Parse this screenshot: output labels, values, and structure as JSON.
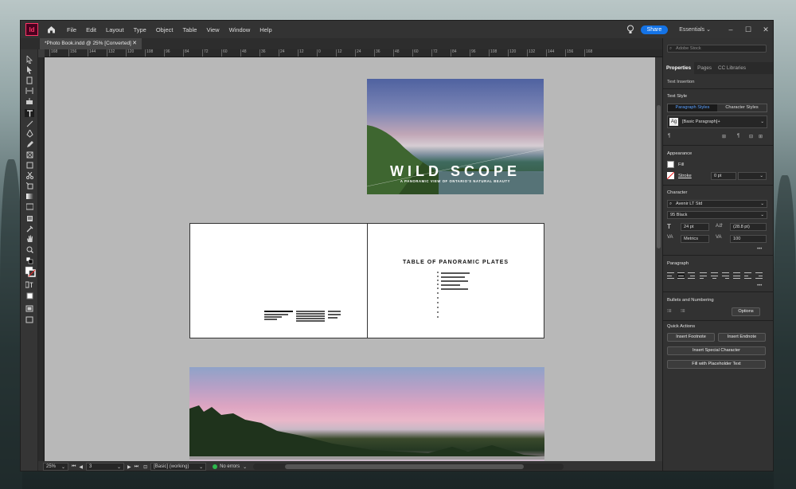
{
  "app": {
    "logo": "Id",
    "menu": [
      "File",
      "Edit",
      "Layout",
      "Type",
      "Object",
      "Table",
      "View",
      "Window",
      "Help"
    ],
    "share_label": "Share",
    "workspace": "Essentials",
    "search_placeholder": "Adobe Stock"
  },
  "document": {
    "tab_title": "*Photo Book.indd @ 25% [Converted]",
    "ruler_ticks": [
      "168",
      "156",
      "144",
      "132",
      "120",
      "108",
      "96",
      "84",
      "72",
      "60",
      "48",
      "36",
      "24",
      "12",
      "0",
      "12",
      "24",
      "36",
      "48",
      "60",
      "72",
      "84",
      "96",
      "108",
      "120",
      "132",
      "144",
      "156",
      "168"
    ],
    "cover_title": "WILD SCOPE",
    "cover_subtitle": "A PANORAMIC VIEW OF ONTARIO'S NATURAL BEAUTY",
    "toc_title": "TABLE OF PANORAMIC PLATES"
  },
  "status": {
    "zoom": "25%",
    "page": "3",
    "style": "[Basic] (working)",
    "errors": "No errors"
  },
  "panel": {
    "tabs": [
      "Properties",
      "Pages",
      "CC Libraries"
    ],
    "context": "Text Insertion",
    "text_style_label": "Text Style",
    "paragraph_styles": "Paragraph Styles",
    "character_styles": "Character Styles",
    "current_style": "[Basic Paragraph]+",
    "appearance_label": "Appearance",
    "fill_label": "Fill",
    "stroke_label": "Stroke",
    "stroke_weight": "0 pt",
    "character_label": "Character",
    "font_family": "Avenir LT Std",
    "font_style": "95 Black",
    "font_size": "24 pt",
    "leading": "(28.8 pt)",
    "kerning": "Metrics",
    "tracking": "100",
    "paragraph_label": "Paragraph",
    "bullets_label": "Bullets and Numbering",
    "options_label": "Options",
    "quick_actions_label": "Quick Actions",
    "insert_footnote": "Insert Footnote",
    "insert_endnote": "Insert Endnote",
    "insert_special": "Insert Special Character",
    "fill_placeholder": "Fill with Placeholder Text",
    "more": "•••"
  }
}
